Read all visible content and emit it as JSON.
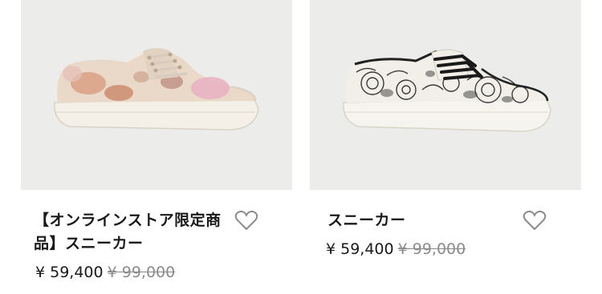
{
  "products": [
    {
      "name": "【オンラインストア限定商品】スニーカー",
      "price": "¥ 59,400",
      "original_price": "¥ 99,000",
      "image_alt": "floral canvas sneaker",
      "favorite_icon": "heart-outline-icon"
    },
    {
      "name": "スニーカー",
      "price": "¥ 59,400",
      "original_price": "¥ 99,000",
      "image_alt": "black and white floral sneaker",
      "favorite_icon": "heart-outline-icon"
    }
  ],
  "colors": {
    "image_bg": "#ececea",
    "text": "#1a1a1a",
    "strike": "#8a8a8a",
    "heart": "#8a8a8a"
  }
}
